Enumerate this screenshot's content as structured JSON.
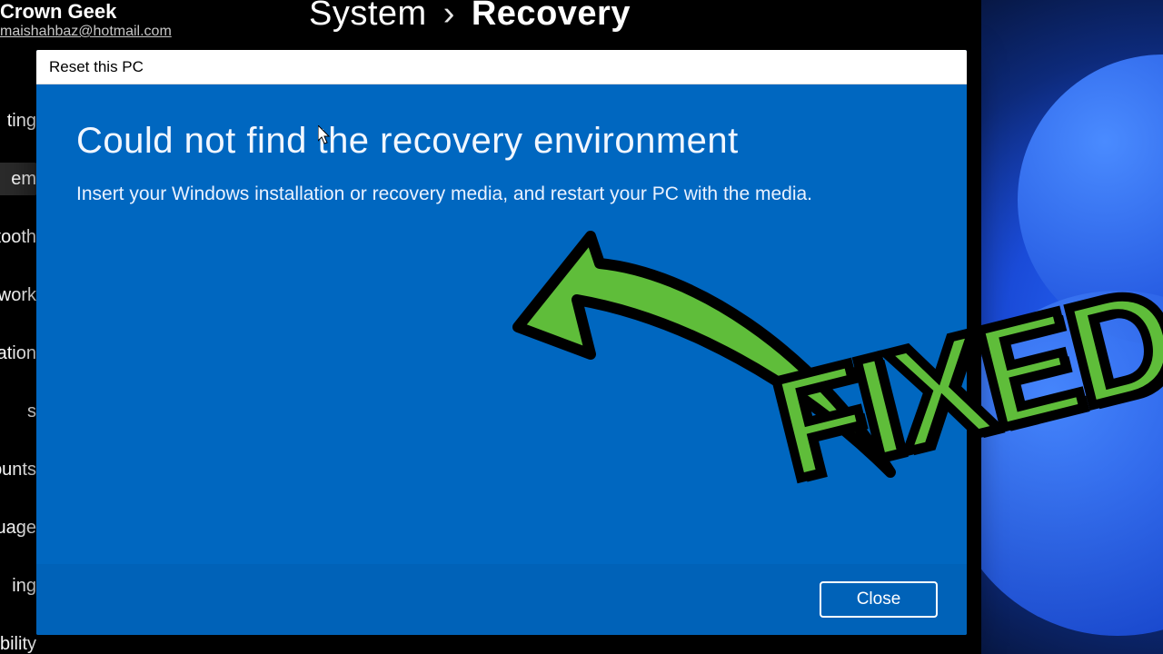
{
  "account": {
    "name": "Crown Geek",
    "email": "maishahbaz@hotmail.com"
  },
  "breadcrumb": {
    "parent": "System",
    "separator": "›",
    "current": "Recovery"
  },
  "sidebar": {
    "items": [
      {
        "label": "ting",
        "selected": false
      },
      {
        "label": "em",
        "selected": true
      },
      {
        "label": "etooth",
        "selected": false
      },
      {
        "label": "work",
        "selected": false
      },
      {
        "label": "onalization",
        "selected": false
      },
      {
        "label": "s",
        "selected": false
      },
      {
        "label": "ounts",
        "selected": false
      },
      {
        "label": "e & language",
        "selected": false
      },
      {
        "label": "ing",
        "selected": false
      },
      {
        "label": "essibility",
        "selected": false
      }
    ]
  },
  "dialog": {
    "title": "Reset this PC",
    "heading": "Could not find the recovery environment",
    "body": "Insert your Windows installation or recovery media, and restart your PC with the media.",
    "close_label": "Close"
  },
  "overlay": {
    "badge": "FIXED",
    "arrow_color": "#5fbd3a"
  }
}
